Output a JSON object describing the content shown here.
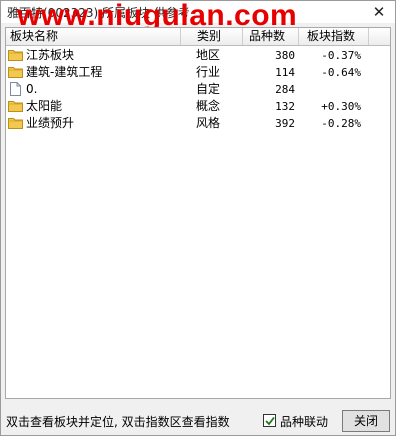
{
  "window": {
    "title": "雅百特(002323)  所属板块  供参考",
    "close_glyph": "✕",
    "watermark": "www.niugulan.com"
  },
  "columns": {
    "name": "板块名称",
    "type": "类别",
    "count": "品种数",
    "index": "板块指数"
  },
  "rows": [
    {
      "icon": "folder-icon",
      "name": "江苏板块",
      "type": "地区",
      "count": "380",
      "change": "-0.37%"
    },
    {
      "icon": "folder-icon",
      "name": "建筑-建筑工程",
      "type": "行业",
      "count": "114",
      "change": "-0.64%"
    },
    {
      "icon": "file-icon",
      "name": "0.",
      "type": "自定",
      "count": "284",
      "change": ""
    },
    {
      "icon": "folder-icon",
      "name": "太阳能",
      "type": "概念",
      "count": "132",
      "change": "+0.30%"
    },
    {
      "icon": "folder-icon",
      "name": "业绩预升",
      "type": "风格",
      "count": "392",
      "change": "-0.28%"
    }
  ],
  "status": {
    "hint": "双击查看板块并定位, 双击指数区查看指数",
    "checkbox_label": "品种联动",
    "checkbox_checked": true,
    "close_button": "关闭"
  },
  "colors": {
    "watermark": "#e60000",
    "folder": "#f2c94c",
    "checkmark": "#1a7a1a"
  }
}
